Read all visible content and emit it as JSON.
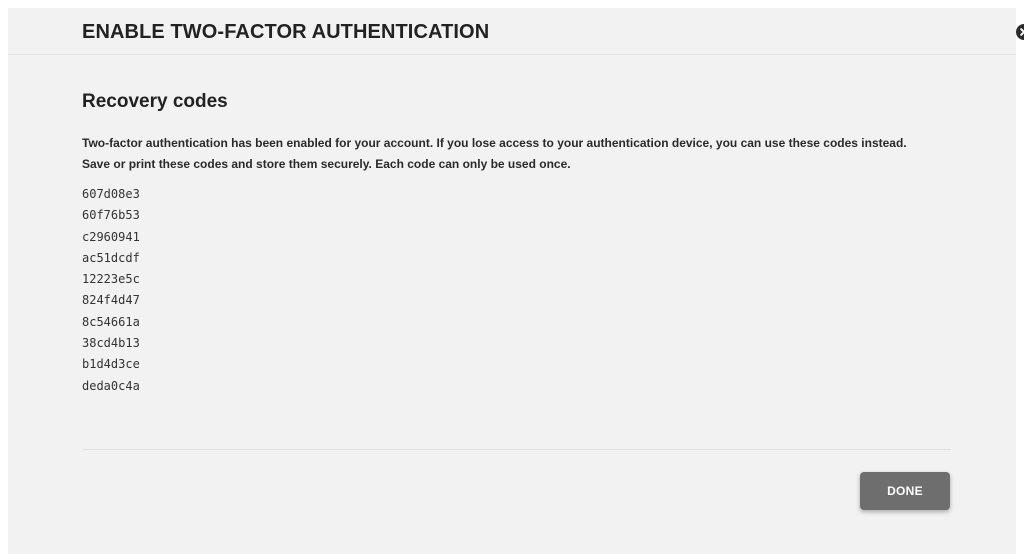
{
  "modal": {
    "title": "ENABLE TWO-FACTOR AUTHENTICATION",
    "close_icon": "close-icon"
  },
  "content": {
    "section_title": "Recovery codes",
    "description": [
      "Two-factor authentication has been enabled for your account. If you lose access to your authentication device, you can use these codes instead.",
      "Save or print these codes and store them securely. Each code can only be used once."
    ],
    "codes": [
      "607d08e3",
      "60f76b53",
      "c2960941",
      "ac51dcdf",
      "12223e5c",
      "824f4d47",
      "8c54661a",
      "38cd4b13",
      "b1d4d3ce",
      "deda0c4a"
    ]
  },
  "footer": {
    "done_label": "DONE"
  },
  "colors": {
    "modal_background": "#f2f2f2",
    "button_background": "#6e6e6e",
    "text": "#222222"
  }
}
